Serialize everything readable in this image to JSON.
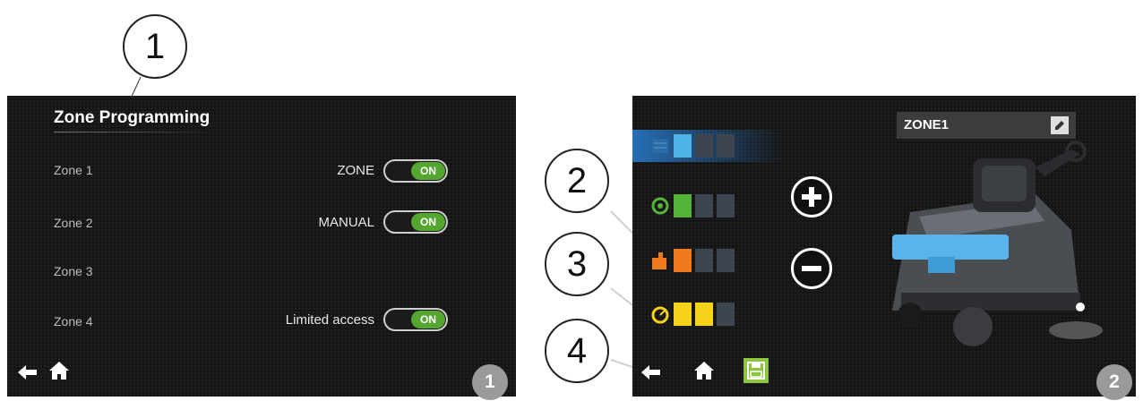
{
  "screen1": {
    "title": "Zone Programming",
    "zones": [
      "Zone 1",
      "Zone 2",
      "Zone 3",
      "Zone 4"
    ],
    "options": [
      {
        "label": "ZONE",
        "toggle": "ON"
      },
      {
        "label": "MANUAL",
        "toggle": "ON"
      },
      {
        "label": "Limited access",
        "toggle": "ON"
      }
    ],
    "nav": {
      "back_icon": "arrow-left-icon",
      "home_icon": "home-icon"
    },
    "badge": "1"
  },
  "screen2": {
    "zone_name": "ZONE1",
    "edit_icon": "pencil-icon",
    "settings": [
      {
        "icon": "brush-speed-icon",
        "color": "#4fb3e6",
        "level": 1,
        "max": 3,
        "highlighted": true
      },
      {
        "icon": "vacuum-icon",
        "color": "#56b33a",
        "level": 1,
        "max": 3
      },
      {
        "icon": "water-icon",
        "color": "#f07b1d",
        "level": 1,
        "max": 3
      },
      {
        "icon": "speed-icon",
        "color": "#f7d21a",
        "level": 2,
        "max": 3
      }
    ],
    "plus_icon": "plus-icon",
    "minus_icon": "minus-icon",
    "nav": {
      "back_icon": "arrow-left-icon",
      "home_icon": "home-icon",
      "save_icon": "save-icon"
    },
    "badge": "2"
  },
  "callouts": [
    "1",
    "2",
    "3",
    "4"
  ],
  "colors": {
    "toggle_on": "#55a531",
    "save_button": "#8cc63f",
    "highlight": "#4fb3e6"
  }
}
